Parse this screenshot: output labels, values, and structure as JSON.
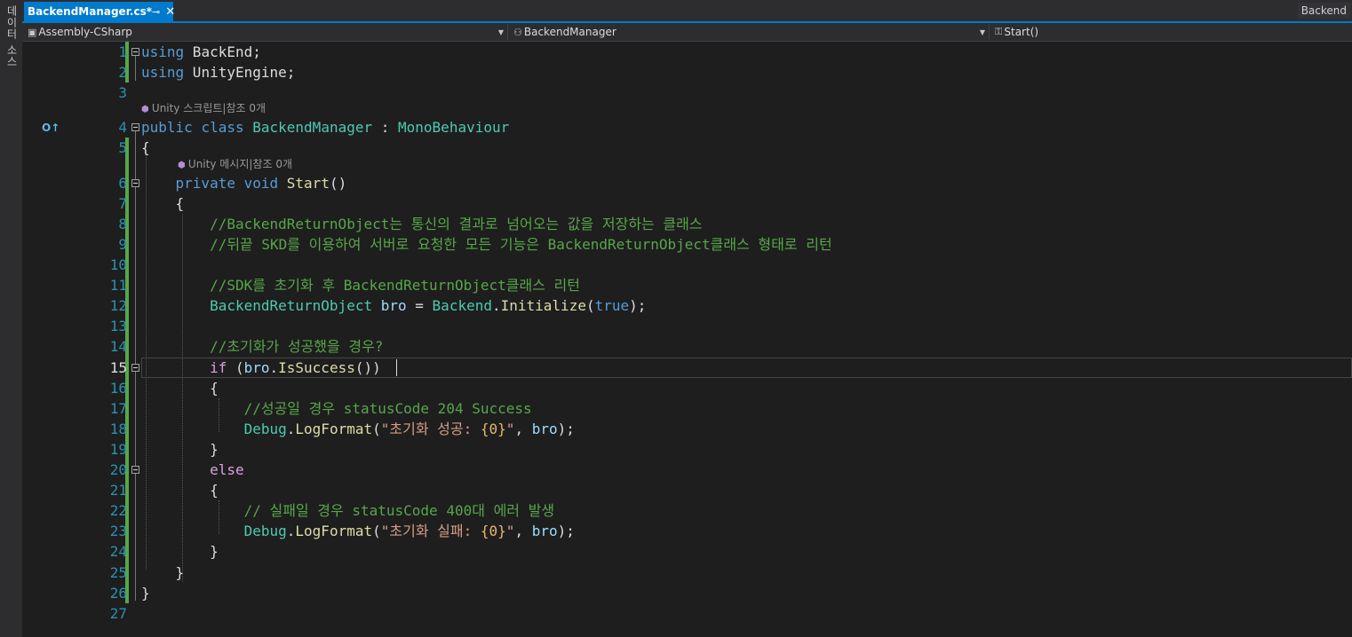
{
  "sidebar": {
    "vertical_label": "데이터 소스"
  },
  "tabs": {
    "active_tab": "BackendManager.cs*",
    "pin_icon": "⊸",
    "close_icon": "✕",
    "right_tab": "Backend"
  },
  "nav": {
    "project": "Assembly-CSharp",
    "class": "BackendManager",
    "member": "Start()"
  },
  "codelens": [
    {
      "text": "Unity 스크립트|참조 0개"
    },
    {
      "text": "Unity 메시지|참조 0개"
    }
  ],
  "current_line": "15",
  "lines": [
    {
      "n": "1",
      "tokens": [
        [
          "kw",
          "using"
        ],
        [
          "",
          " BackEnd;"
        ]
      ]
    },
    {
      "n": "2",
      "tokens": [
        [
          "kw",
          "using"
        ],
        [
          "",
          " UnityEngine;"
        ]
      ]
    },
    {
      "n": "3",
      "tokens": []
    },
    {
      "n": "4",
      "tokens": [
        [
          "kw",
          "public"
        ],
        [
          "",
          " "
        ],
        [
          "kw",
          "class"
        ],
        [
          "",
          " "
        ],
        [
          "ty",
          "BackendManager"
        ],
        [
          "",
          " : "
        ],
        [
          "ty",
          "MonoBehaviour"
        ]
      ]
    },
    {
      "n": "5",
      "tokens": [
        [
          "",
          "{"
        ]
      ]
    },
    {
      "n": "6",
      "tokens": [
        [
          "",
          "    "
        ],
        [
          "kw",
          "private"
        ],
        [
          "",
          " "
        ],
        [
          "kw",
          "void"
        ],
        [
          "",
          " "
        ],
        [
          "fn",
          "Start"
        ],
        [
          "",
          "()"
        ]
      ]
    },
    {
      "n": "7",
      "tokens": [
        [
          "",
          "    {"
        ]
      ]
    },
    {
      "n": "8",
      "tokens": [
        [
          "",
          "        "
        ],
        [
          "cm",
          "//BackendReturnObject는 통신의 결과로 넘어오는 값을 저장하는 클래스"
        ]
      ]
    },
    {
      "n": "9",
      "tokens": [
        [
          "",
          "        "
        ],
        [
          "cm",
          "//뒤끝 SKD를 이용하여 서버로 요청한 모든 기능은 BackendReturnObject클래스 형태로 리턴"
        ]
      ]
    },
    {
      "n": "10",
      "tokens": []
    },
    {
      "n": "11",
      "tokens": [
        [
          "",
          "        "
        ],
        [
          "cm",
          "//SDK를 초기화 후 BackendReturnObject클래스 리턴"
        ]
      ]
    },
    {
      "n": "12",
      "tokens": [
        [
          "",
          "        "
        ],
        [
          "ty",
          "BackendReturnObject"
        ],
        [
          "",
          " "
        ],
        [
          "var",
          "bro"
        ],
        [
          "",
          " = "
        ],
        [
          "ty",
          "Backend"
        ],
        [
          "",
          "."
        ],
        [
          "fn",
          "Initialize"
        ],
        [
          "",
          "("
        ],
        [
          "kw",
          "true"
        ],
        [
          "",
          ");"
        ]
      ]
    },
    {
      "n": "13",
      "tokens": []
    },
    {
      "n": "14",
      "tokens": [
        [
          "",
          "        "
        ],
        [
          "cm",
          "//초기화가 성공했을 경우?"
        ]
      ]
    },
    {
      "n": "15",
      "tokens": [
        [
          "",
          "        "
        ],
        [
          "ctl",
          "if"
        ],
        [
          "",
          " ("
        ],
        [
          "var",
          "bro"
        ],
        [
          "",
          "."
        ],
        [
          "fn",
          "IsSuccess"
        ],
        [
          "",
          "())"
        ]
      ]
    },
    {
      "n": "16",
      "tokens": [
        [
          "",
          "        {"
        ]
      ]
    },
    {
      "n": "17",
      "tokens": [
        [
          "",
          "            "
        ],
        [
          "cm",
          "//성공일 경우 statusCode 204 Success"
        ]
      ]
    },
    {
      "n": "18",
      "tokens": [
        [
          "",
          "            "
        ],
        [
          "ty",
          "Debug"
        ],
        [
          "",
          "."
        ],
        [
          "fn",
          "LogFormat"
        ],
        [
          "",
          "("
        ],
        [
          "str",
          "\"초기화 성공: "
        ],
        [
          "fmt",
          "{0}"
        ],
        [
          "str",
          "\""
        ],
        [
          "",
          ", "
        ],
        [
          "var",
          "bro"
        ],
        [
          "",
          ");"
        ]
      ]
    },
    {
      "n": "19",
      "tokens": [
        [
          "",
          "        }"
        ]
      ]
    },
    {
      "n": "20",
      "tokens": [
        [
          "",
          "        "
        ],
        [
          "ctl",
          "else"
        ]
      ]
    },
    {
      "n": "21",
      "tokens": [
        [
          "",
          "        {"
        ]
      ]
    },
    {
      "n": "22",
      "tokens": [
        [
          "",
          "            "
        ],
        [
          "cm",
          "// 실패일 경우 statusCode 400대 에러 발생"
        ]
      ]
    },
    {
      "n": "23",
      "tokens": [
        [
          "",
          "            "
        ],
        [
          "ty",
          "Debug"
        ],
        [
          "",
          "."
        ],
        [
          "fn",
          "LogFormat"
        ],
        [
          "",
          "("
        ],
        [
          "str",
          "\"초기화 실패: "
        ],
        [
          "fmt",
          "{0}"
        ],
        [
          "str",
          "\""
        ],
        [
          "",
          ", "
        ],
        [
          "var",
          "bro"
        ],
        [
          "",
          ");"
        ]
      ]
    },
    {
      "n": "24",
      "tokens": [
        [
          "",
          "        }"
        ]
      ]
    },
    {
      "n": "25",
      "tokens": [
        [
          "",
          "    }"
        ]
      ]
    },
    {
      "n": "26",
      "tokens": [
        [
          "",
          "}"
        ]
      ]
    },
    {
      "n": "27",
      "tokens": []
    }
  ],
  "colors": {
    "background": "#1e1e1e",
    "accent": "#007acc",
    "keyword": "#569cd6",
    "control": "#d8a0df",
    "type": "#4ec9b0",
    "method": "#dcdcaa",
    "variable": "#9cdcfe",
    "comment": "#57a64a",
    "string": "#d69d85",
    "line_number": "#2b91af"
  },
  "icons": {
    "margin_glyph": "override-icon",
    "codelens_glyph": "unity-cube-icon"
  }
}
